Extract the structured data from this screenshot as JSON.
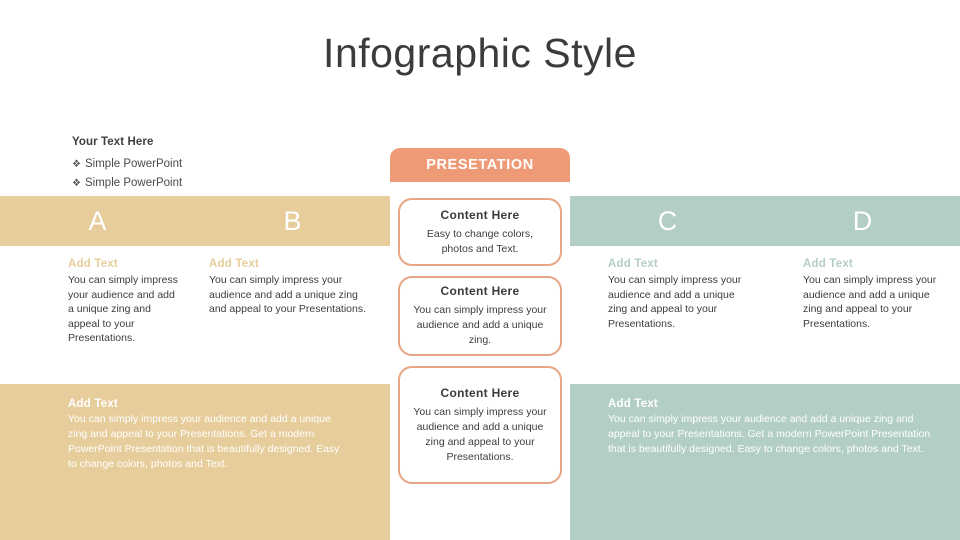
{
  "slide": {
    "title": "Infographic Style"
  },
  "legend": {
    "title": "Your Text Here",
    "bullet_glyph": "❖",
    "items": [
      {
        "label": "Simple PowerPoint"
      },
      {
        "label": "Simple PowerPoint"
      }
    ]
  },
  "badge": {
    "label": "PRESETATION",
    "color": "#ef9a76"
  },
  "cards": [
    {
      "heading": "Content  Here",
      "text": "Easy to change colors, photos and Text.",
      "border_color": "#e8a583"
    },
    {
      "heading": "Content  Here",
      "text": "You can simply impress your audience and add a unique zing.",
      "border_color": "#e8a583"
    },
    {
      "heading": "Content  Here",
      "text": "You can simply impress your audience and add a unique zing and appeal to your Presentations.",
      "border_color": "#e8a583"
    }
  ],
  "panels": {
    "left": {
      "accent_color": "#e6cd9b",
      "columns": [
        {
          "letter": "A",
          "heading": "Add Text",
          "text": "You can simply impress your audience and add a unique zing and appeal to your Presentations."
        },
        {
          "letter": "B",
          "heading": "Add Text",
          "text": "You can simply impress your audience and add a unique zing and appeal to your Presentations."
        }
      ],
      "footer": {
        "heading": "Add Text",
        "text": "You can simply impress your audience and add a unique zing and appeal to your Presentations. Get a modern PowerPoint  Presentation that is beautifully designed. Easy to change colors, photos and Text."
      }
    },
    "right": {
      "accent_color": "#b2cec5",
      "columns": [
        {
          "letter": "C",
          "heading": "Add Text",
          "text": "You can simply impress your audience and add a unique zing and appeal to your Presentations."
        },
        {
          "letter": "D",
          "heading": "Add Text",
          "text": "You can simply impress your audience and add a unique zing and appeal to your Presentations."
        }
      ],
      "footer": {
        "heading": "Add Text",
        "text": "You can simply impress your audience and add a unique zing and appeal to your Presentations. Get a modern PowerPoint  Presentation that is beautifully designed. Easy to change colors, photos and Text."
      }
    }
  }
}
